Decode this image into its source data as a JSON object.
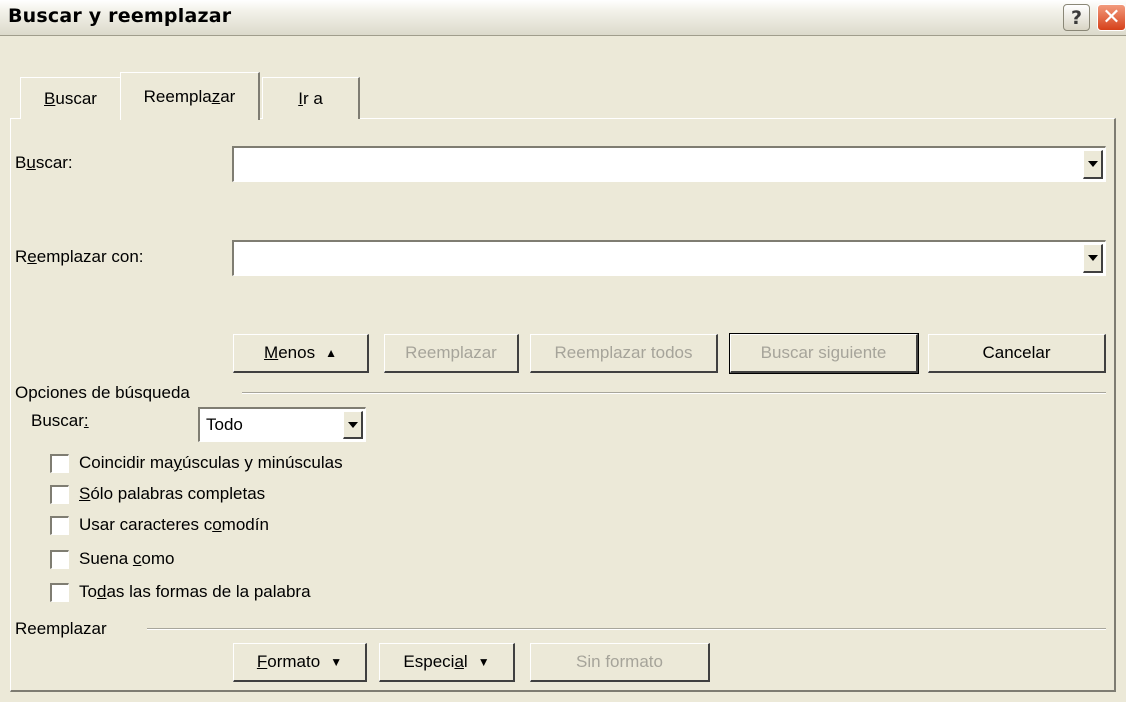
{
  "window": {
    "title": "Buscar y reemplazar"
  },
  "title_buttons": {
    "help": "?",
    "close": "✕"
  },
  "tabs": [
    {
      "pre": "",
      "key": "B",
      "post": "uscar"
    },
    {
      "pre": "Reempla",
      "key": "z",
      "post": "ar"
    },
    {
      "pre": "",
      "key": "I",
      "post": "r a"
    }
  ],
  "active_tab": "Reemplazar",
  "find": {
    "pre": "B",
    "key": "u",
    "post": "scar:",
    "value": ""
  },
  "replace": {
    "pre": "R",
    "key": "e",
    "post": "emplazar con:",
    "value": ""
  },
  "buttons": {
    "less": {
      "pre": "",
      "key": "M",
      "post": "enos",
      "icon": "▲"
    },
    "replace": "Reemplazar",
    "replace_all": "Reemplazar todos",
    "find_next": "Buscar siguiente",
    "cancel": "Cancelar"
  },
  "search_options": {
    "heading": "Opciones de búsqueda",
    "scope_label": {
      "pre": "Buscar",
      "key": ":",
      "post": ""
    },
    "scope_value": "Todo",
    "options": [
      {
        "pre": "Coincidir ma",
        "key": "y",
        "post": "úsculas y minúsculas",
        "checked": false
      },
      {
        "pre": "",
        "key": "S",
        "post": "ólo palabras completas",
        "checked": false
      },
      {
        "pre": "Usar caracteres c",
        "key": "o",
        "post": "modín",
        "checked": false
      },
      {
        "pre": "Suena ",
        "key": "c",
        "post": "omo",
        "checked": false
      },
      {
        "pre": "To",
        "key": "d",
        "post": "as las formas de la palabra",
        "checked": false
      }
    ]
  },
  "replace_section": {
    "heading": "Reemplazar",
    "format": {
      "pre": "",
      "key": "F",
      "post": "ormato",
      "icon": "▼"
    },
    "special": {
      "pre": "Especi",
      "key": "a",
      "post": "l",
      "icon": "▼"
    },
    "no_format": "Sin formato"
  }
}
